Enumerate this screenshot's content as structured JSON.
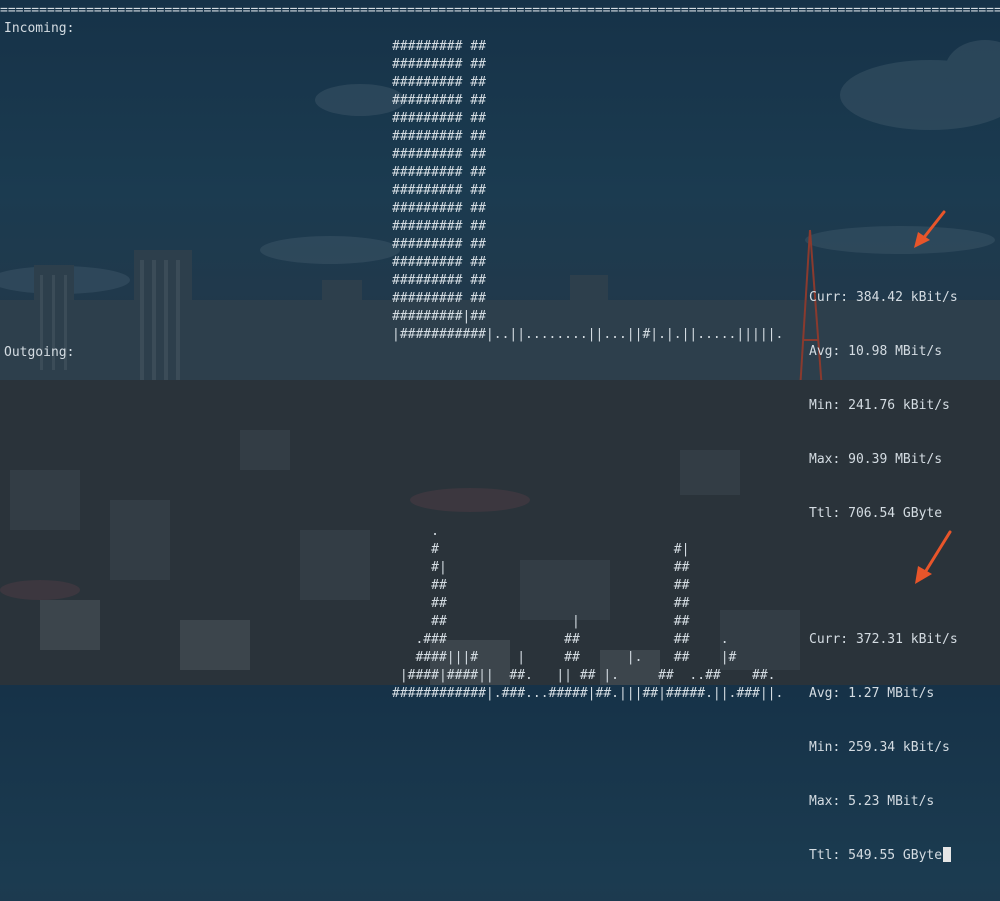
{
  "terminal": {
    "divider": "================================================================================================================================================================",
    "incoming": {
      "label": "Incoming:",
      "graph_rows": [
        "######### ##",
        "######### ##",
        "######### ##",
        "######### ##",
        "######### ##",
        "######### ##",
        "######### ##",
        "######### ##",
        "######### ##",
        "######### ##",
        "######### ##",
        "######### ##",
        "######### ##",
        "######### ##",
        "######### ##",
        "#########|##",
        "|###########|..||........||...||#|.|.||.....|||||."
      ],
      "stats": {
        "curr": "Curr: 384.42 kBit/s",
        "avg": "Avg: 10.98 MBit/s",
        "min": "Min: 241.76 kBit/s",
        "max": "Max: 90.39 MBit/s",
        "ttl": "Ttl: 706.54 GByte"
      }
    },
    "outgoing": {
      "label": "Outgoing:",
      "graph_rows": [
        "",
        "     .",
        "     #                              #|",
        "     #|                             ##",
        "     ##                             ##",
        "     ##                             ##",
        "     ##                |            ##",
        "   .###               ##            ##    .",
        "   ####|||#     |     ##      |.    ##    |#",
        " |####|####||  ##.   || ## |.     ##  ..##    ##.",
        "############|.###...#####|##.|||##|#####.||.###||."
      ],
      "stats": {
        "curr": "Curr: 372.31 kBit/s",
        "avg": "Avg: 1.27 MBit/s",
        "min": "Min: 259.34 kBit/s",
        "max": "Max: 5.23 MBit/s",
        "ttl": "Ttl: 549.55 GByte"
      }
    }
  },
  "annotations": {
    "arrow_color": "#e8552a",
    "arrow_icon": "arrow-down-left-icon"
  }
}
